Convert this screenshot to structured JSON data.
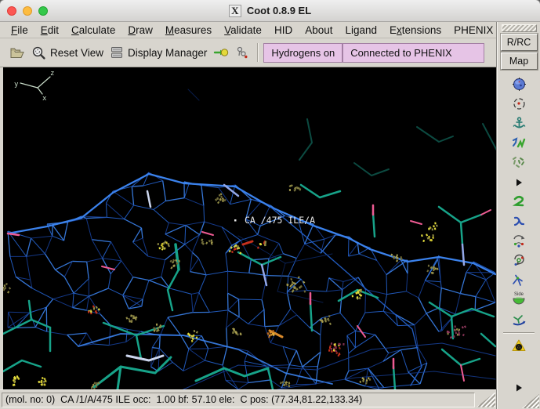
{
  "window": {
    "title": "Coot 0.8.9 EL",
    "x11_icon": "X"
  },
  "menubar": {
    "items": [
      {
        "label": "File",
        "mnemonic": 0
      },
      {
        "label": "Edit",
        "mnemonic": 0
      },
      {
        "label": "Calculate",
        "mnemonic": 0
      },
      {
        "label": "Draw",
        "mnemonic": 0
      },
      {
        "label": "Measures",
        "mnemonic": 0
      },
      {
        "label": "Validate",
        "mnemonic": 0
      },
      {
        "label": "HID",
        "mnemonic": -1
      },
      {
        "label": "About",
        "mnemonic": -1
      },
      {
        "label": "Ligand",
        "mnemonic": -1
      },
      {
        "label": "Extensions",
        "mnemonic": 1
      },
      {
        "label": "PHENIX",
        "mnemonic": -1
      }
    ]
  },
  "toolbar": {
    "reset_view_label": "Reset View",
    "display_manager_label": "Display Manager",
    "hydrogens_label": "Hydrogens on",
    "phenix_label": "Connected to PHENIX",
    "icons": [
      "open-folder-icon",
      "reset-view-magnifier-icon",
      "display-manager-stack-icon",
      "go-to-atom-icon",
      "label-atom-molecule-icon"
    ]
  },
  "side_panel": {
    "rrc_label": "R/RC",
    "map_label": "Map",
    "side_flip_label": "Side",
    "tools": [
      "map-sphere",
      "recentre-view",
      "anchor-pin",
      "real-space-refine-zone",
      "refine-fragment",
      "more-tools",
      "regularize-zone",
      "rigid-body-fit-zone",
      "rotate-translate-zone",
      "edit-chi-angles",
      "pepflip",
      "side-chain-flip-180",
      "auto-fit-rotamer",
      "mutate-residue",
      "more-tools-bottom"
    ]
  },
  "viewport": {
    "atom_label": "CA /475 ILE/A",
    "axis_x": "x",
    "axis_y": "y",
    "axis_z": "z"
  },
  "statusbar": {
    "text": "(mol. no: 0)  CA /1/A/475 ILE occ:  1.00 bf: 57.10 ele:  C pos: (77.34,81.22,133.34)"
  },
  "colors": {
    "canvas_bg": "#000000",
    "mesh_bright": "#3b82ec",
    "mesh_mid": "#2563cf",
    "mesh_dim": "#173f96",
    "mesh_faint": "#0d2a6b",
    "stick_teal": "#17a389",
    "stick_dim": "#0c4a41",
    "stick_periwinkle": "#93a7e8",
    "stick_pink": "#ee5b93",
    "stick_light": "#ccd6ee",
    "stick_red": "#c5301d",
    "stick_orange": "#d98a2b",
    "dots_yellow": "#e3dc3c",
    "dots_olive": "#8f8a45",
    "dots_red": "#c22f1b",
    "dots_maroon": "#7e3050",
    "axes": "#c9dcc9",
    "label_text": "#e9e9e9",
    "chrome_bg": "#d8d5ce",
    "pink_button_bg": "#e6c4e6"
  }
}
